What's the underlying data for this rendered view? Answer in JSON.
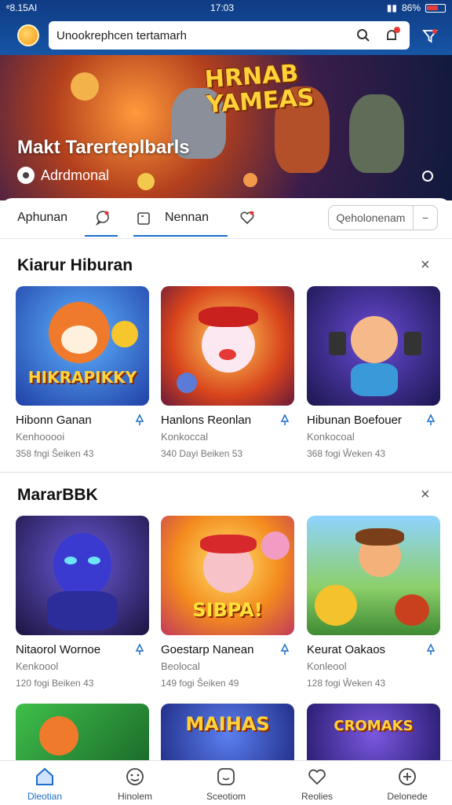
{
  "status_bar": {
    "time": "ᵉ8.15AI",
    "center": "17:03",
    "battery": "86%"
  },
  "search": {
    "text": "Unookrephcen tertamarh"
  },
  "banner": {
    "logo_text": "HRNAB YAMEAS",
    "title": "Makt Tarerteplbarls",
    "subtitle": "Adrdmonal"
  },
  "tabs": {
    "first": "Aphunan",
    "second": "Nennan",
    "sort_label": "Qeholonenam",
    "sort_caret": "−"
  },
  "sections": [
    {
      "title": "Kiarur Hiburan",
      "close": "×",
      "cards": [
        {
          "name": "Hibonn Ganan",
          "category": "Kenhooooi",
          "meta": "358 fngi Ŝeiken   43",
          "art": "HIKRAPIKKY"
        },
        {
          "name": "Hanlons Reonlan",
          "category": "Konkoccal",
          "meta": "340 Dayi Beiken   53",
          "art": ""
        },
        {
          "name": "Hibunan Boefouer",
          "category": "Konkocoal",
          "meta": "368 fogi Ŵeken   43",
          "art": ""
        }
      ]
    },
    {
      "title": "MararBBK",
      "close": "×",
      "cards": [
        {
          "name": "Nitaorol Wornoe",
          "category": "Kenkoool",
          "meta": "120 fogi Beiken   43",
          "art": ""
        },
        {
          "name": "Goestarp Nanean",
          "category": "Beolocal",
          "meta": "149 fogi Ŝeiken   49",
          "art": "SIBPA!"
        },
        {
          "name": "Keurat Oakaos",
          "category": "Konleool",
          "meta": "128 fogi Ŵeken   43",
          "art": ""
        }
      ]
    }
  ],
  "partial_row": [
    "",
    "MAIHAS",
    "CROMAKS"
  ],
  "bottom_nav": [
    "Dleotian",
    "Hinolem",
    "Sceotiom",
    "Reolies",
    "Delonede"
  ],
  "colors": {
    "topbar": "#1655a6",
    "accent": "#1e6fc7",
    "notify": "#e53935"
  }
}
